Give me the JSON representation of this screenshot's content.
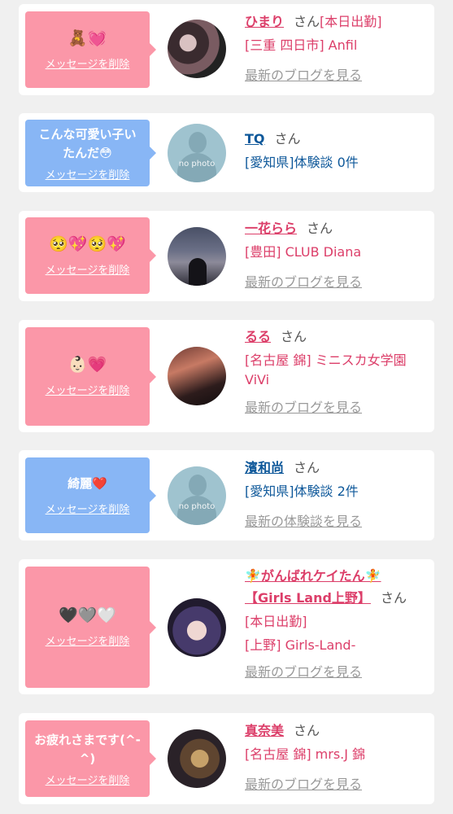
{
  "delete_label": "メッセージを削除",
  "san": "さん",
  "cards": [
    {
      "message": "🧸💓",
      "sender": "ひまり",
      "line1_suffix": "[本日出勤]",
      "line2": "[三重 四日市] Anfil",
      "link": "最新のブログを見る"
    },
    {
      "message": "こんな可愛い子い\nたんだ😳",
      "sender": "TQ",
      "line1": "[愛知県]体験談 0件",
      "avatar_text": "no photo"
    },
    {
      "message": "🥺💖🥺💖",
      "sender": "一花らら",
      "line1": "[豊田] CLUB Diana",
      "link": "最新のブログを見る"
    },
    {
      "message": "👶🏻💗",
      "sender": "るる",
      "line1": "[名古屋 錦] ミニスカ女学園",
      "line2": "ViVi",
      "link": "最新のブログを見る"
    },
    {
      "message": "綺麗❤️",
      "sender": "濱和尚",
      "line1": "[愛知県]体験談 2件",
      "link": "最新の体験談を見る",
      "avatar_text": "no photo"
    },
    {
      "message": "🖤🩶🤍",
      "sender": "🧚がんばれケイたん🧚",
      "sender2": "【Girls Land上野】",
      "line1": "[本日出勤]",
      "line2": "[上野] Girls-Land-",
      "link": "最新のブログを見る"
    },
    {
      "message": "お疲れさまです(^-\n^)",
      "sender": "真奈美",
      "line1": "[名古屋 錦] mrs.J 錦",
      "link": "最新のブログを見る"
    }
  ]
}
